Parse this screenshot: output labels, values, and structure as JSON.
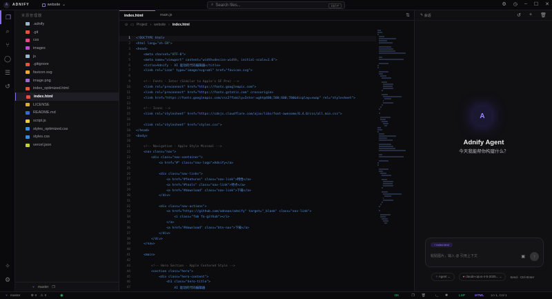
{
  "app": {
    "brand": "ADNIFY",
    "project": "website",
    "search_placeholder": "Search files...",
    "search_shortcut": "Ctrl P"
  },
  "sidebar": {
    "title": "资源管理器",
    "files": [
      {
        "name": ".adnify",
        "color": "#9cb4c8",
        "active": false
      },
      {
        "name": ".git",
        "color": "#e0543a",
        "active": false
      },
      {
        "name": "css",
        "color": "#e04a8a",
        "active": false
      },
      {
        "name": "images",
        "color": "#c04ad0",
        "active": false
      },
      {
        "name": "js",
        "color": "#9cb4c8",
        "active": false
      },
      {
        "name": ".gitignore",
        "color": "#e0543a",
        "active": false
      },
      {
        "name": "favicon.svg",
        "color": "#f0a830",
        "active": false
      },
      {
        "name": "image.png",
        "color": "#9a6ad0",
        "active": false
      },
      {
        "name": "index_optimized.html",
        "color": "#e0543a",
        "active": false
      },
      {
        "name": "index.html",
        "color": "#e0543a",
        "active": true
      },
      {
        "name": "LICENSE",
        "color": "#d8b030",
        "active": false
      },
      {
        "name": "README.md",
        "color": "#3a6ad0",
        "active": false
      },
      {
        "name": "script.js",
        "color": "#e8d030",
        "active": false
      },
      {
        "name": "styles_optimized.css",
        "color": "#3a8ae0",
        "active": false
      },
      {
        "name": "styles.css",
        "color": "#3a8ae0",
        "active": false
      },
      {
        "name": "vercel.json",
        "color": "#c0d040",
        "active": false
      }
    ],
    "branch": "master"
  },
  "editor": {
    "tabs": [
      {
        "label": "index.html",
        "active": true
      },
      {
        "label": "main.js",
        "active": false
      }
    ],
    "breadcrumb": [
      "Project",
      "website",
      "index.html"
    ],
    "lines": [
      "<!DOCTYPE html>",
      "<html lang=\"zh-CN\">",
      "<head>",
      "    <meta charset=\"UTF-8\">",
      "    <meta name=\"viewport\" content=\"width=device-width, initial-scale=1.0\">",
      "    <title>Adnify - AI 驱动的代码编辑器</title>",
      "    <link rel=\"icon\" type=\"image/svg+xml\" href=\"favicon.svg\">",
      "",
      "    <!-- Fonts - Inter (Similar to Apple's SF Pro) -->",
      "    <link rel=\"preconnect\" href=\"https://fonts.googleapis.com\">",
      "    <link rel=\"preconnect\" href=\"https://fonts.gstatic.com\" crossorigin>",
      "    <link href=\"https://fonts.googleapis.com/css2?family=Inter:wght@400;500;600;700&display=swap\" rel=\"stylesheet\">",
      "",
      "    <!-- Icons -->",
      "    <link rel=\"stylesheet\" href=\"https://cdnjs.cloudflare.com/ajax/libs/font-awesome/6.4.0/css/all.min.css\">",
      "",
      "    <link rel=\"stylesheet\" href=\"styles.css\">",
      "</head>",
      "<body>",
      "",
      "    <!-- Navigation - Apple Style Minimal -->",
      "    <nav class=\"nav\">",
      "        <div class=\"nav-container\">",
      "            <a href=\"#\" class=\"nav-logo\">Adnify</a>",
      "",
      "            <div class=\"nav-links\">",
      "                <a href=\"#features\" class=\"nav-link\">特性</a>",
      "                <a href=\"#tools\" class=\"nav-link\">特点</a>",
      "                <a href=\"#download\" class=\"nav-link\">下载</a>",
      "            </div>",
      "",
      "            <div class=\"nav-actions\">",
      "                <a href=\"https://github.com/adnaan/adnify\" target=\"_blank\" class=\"nav-link\">",
      "                    <i class=\"fab fa-github\"></i>",
      "                </a>",
      "                <a href=\"#download\" class=\"btn-nav\">下载</a>",
      "            </div>",
      "        </div>",
      "    </nav>",
      "",
      "    <main>",
      "",
      "        <!-- Hero Section - Apple Centered Style -->",
      "        <section class=\"hero\">",
      "            <div class=\"hero-content\">",
      "                <h1 class=\"hero-title\">",
      "                    AI 驱动的代码编辑器"
    ]
  },
  "agent": {
    "mode_label": "会话",
    "title": "Adnify Agent",
    "subtitle": "今天我能帮你构建什么？",
    "chip": "+ index.html",
    "input_placeholder": "粘贴图片，输入 @ 引用上下文",
    "mode": "Agent",
    "model": "claude-opus-4-5-2025...",
    "extra": "Send · Ctrl+Enter"
  },
  "status": {
    "branch": "master",
    "errors": "0",
    "warnings": "0",
    "sync": "OK",
    "lsp": "LSP",
    "language": "HTML",
    "position": "Ln 1, Col 1"
  },
  "colors": {
    "accent": "#8a6cf0",
    "background": "#0c0c0e"
  }
}
